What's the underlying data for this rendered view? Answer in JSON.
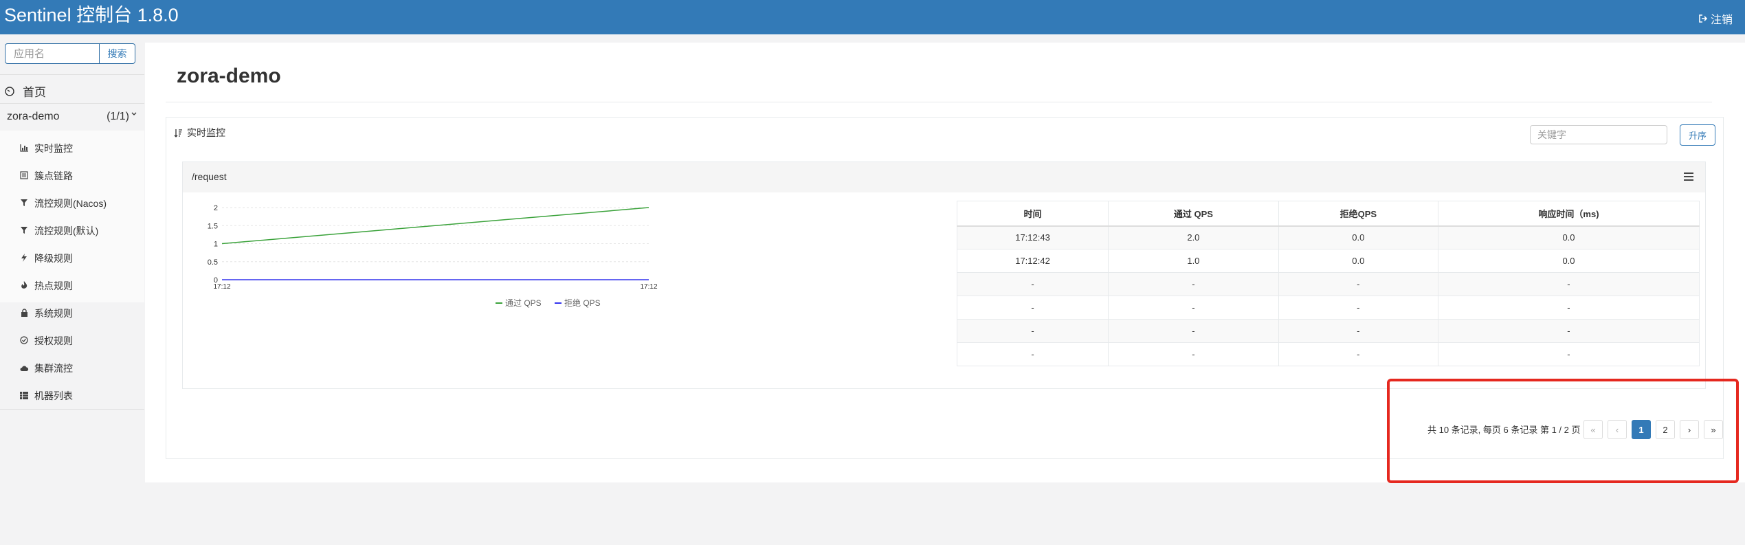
{
  "header": {
    "brand": "Sentinel 控制台 1.8.0",
    "logout_label": "注销",
    "logout_icon": "sign-out-icon"
  },
  "sidebar": {
    "search": {
      "placeholder": "应用名",
      "button_label": "搜索"
    },
    "home_label": "首页",
    "app": {
      "name": "zora-demo",
      "count": "(1/1)"
    },
    "items": [
      {
        "label": "实时监控",
        "icon": "bar-chart-icon"
      },
      {
        "label": "簇点链路",
        "icon": "list-alt-icon"
      },
      {
        "label": "流控规则(Nacos)",
        "icon": "filter-icon"
      },
      {
        "label": "流控规则(默认)",
        "icon": "filter-icon"
      },
      {
        "label": "降级规则",
        "icon": "flash-icon"
      },
      {
        "label": "热点规则",
        "icon": "fire-icon"
      },
      {
        "label": "系统规则",
        "icon": "lock-icon"
      },
      {
        "label": "授权规则",
        "icon": "check-icon"
      },
      {
        "label": "集群流控",
        "icon": "cloud-icon"
      },
      {
        "label": "机器列表",
        "icon": "list-icon"
      }
    ]
  },
  "main": {
    "page_title": "zora-demo",
    "panel_title": "实时监控",
    "keyword_placeholder": "关键字",
    "sort_button": "升序",
    "resource": "/request",
    "table": {
      "headers": [
        "时间",
        "通过 QPS",
        "拒绝QPS",
        "响应时间（ms)"
      ],
      "rows": [
        [
          "17:12:43",
          "2.0",
          "0.0",
          "0.0"
        ],
        [
          "17:12:42",
          "1.0",
          "0.0",
          "0.0"
        ],
        [
          "-",
          "-",
          "-",
          "-"
        ],
        [
          "-",
          "-",
          "-",
          "-"
        ],
        [
          "-",
          "-",
          "-",
          "-"
        ],
        [
          "-",
          "-",
          "-",
          "-"
        ]
      ]
    },
    "pagination": {
      "info": "共 10 条记录, 每页 6 条记录 第 1 / 2 页",
      "first": "«",
      "prev": "‹",
      "pages": [
        "1",
        "2"
      ],
      "next": "›",
      "last": "»"
    }
  },
  "chart_data": {
    "type": "line",
    "x": [
      "17:12",
      "17:12"
    ],
    "series": [
      {
        "name": "通过 QPS",
        "values": [
          1,
          2
        ],
        "color": "#3aa23a"
      },
      {
        "name": "拒绝 QPS",
        "values": [
          0,
          0
        ],
        "color": "#3333ee"
      }
    ],
    "yticks": [
      "0",
      "0.5",
      "1",
      "1.5",
      "2"
    ],
    "ylim": [
      0,
      2
    ],
    "legend_position": "bottom-center"
  },
  "colors": {
    "header_bg": "#337ab7",
    "accent": "#337ab7",
    "highlight_border": "#e5281f"
  }
}
